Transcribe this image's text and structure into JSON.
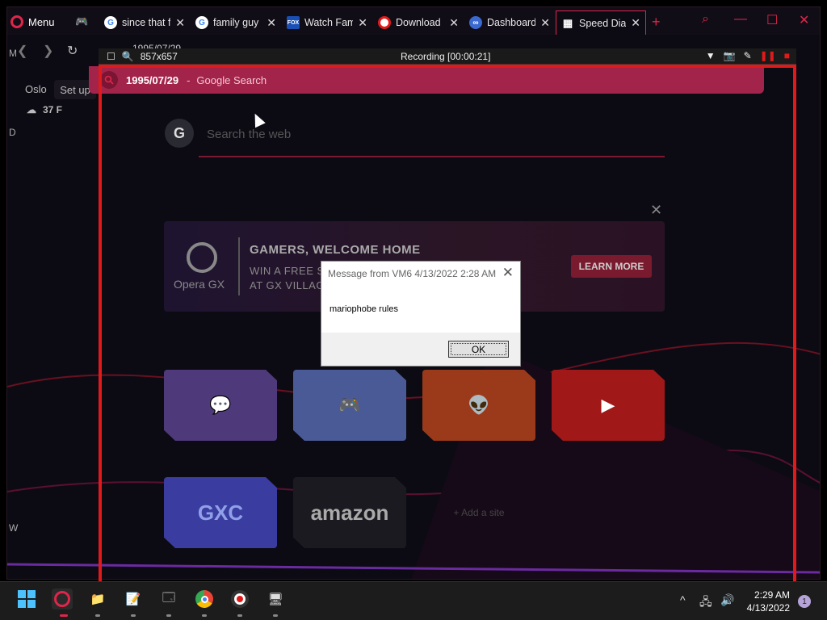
{
  "tabs": {
    "menu_label": "Menu",
    "items": [
      {
        "label": "since that f",
        "icon": "google-icon"
      },
      {
        "label": "family guy",
        "icon": "google-icon"
      },
      {
        "label": "Watch Fam",
        "icon": "fox-icon"
      },
      {
        "label": "Download",
        "icon": "record-icon"
      },
      {
        "label": "Dashboard",
        "icon": "dashboard-icon"
      },
      {
        "label": "Speed Dial",
        "icon": "grid-icon",
        "active": true
      }
    ]
  },
  "address_bar": {
    "value": "1995/07/29"
  },
  "recorder": {
    "size": "857x657",
    "title": "Recording [00:00:21]"
  },
  "suggestion": {
    "query": "1995/07/29",
    "separator": "-",
    "engine": "Google Search"
  },
  "sidebar": {
    "city": "Oslo",
    "setup_label": "Set up",
    "temperature": "37 F",
    "edge_letters": [
      "M",
      "D",
      "W"
    ]
  },
  "search": {
    "placeholder": "Search the web",
    "logo": "G"
  },
  "promo": {
    "logo_text": "Opera GX",
    "title": "GAMERS, WELCOME HOME",
    "line1": "WIN A FREE S",
    "line2": "AT GX VILLAG",
    "button_label": "LEARN MORE"
  },
  "speed_dial": {
    "tiles": [
      {
        "name": "twitch",
        "label": "",
        "color": "#4e3a7a"
      },
      {
        "name": "discord",
        "label": "",
        "color": "#4a5a96"
      },
      {
        "name": "reddit",
        "label": "",
        "color": "#9a3a1a"
      },
      {
        "name": "youtube",
        "label": "",
        "color": "#a01818"
      },
      {
        "name": "gxc",
        "label": "GXC",
        "color": "#3a3ca0"
      },
      {
        "name": "amazon",
        "label": "amazon",
        "color": "#1a1a20"
      }
    ],
    "add_site_label": "+ Add a site"
  },
  "dialog": {
    "title": "Message from VM6 4/13/2022 2:28 AM",
    "message": "mariophobe rules",
    "ok_label": "OK"
  },
  "taskbar": {
    "time": "2:29 AM",
    "date": "4/13/2022",
    "notification_count": "1"
  },
  "colors": {
    "accent": "#e0254a",
    "recorder_frame": "#e01a1a",
    "suggestion_bg": "#a3244a"
  }
}
